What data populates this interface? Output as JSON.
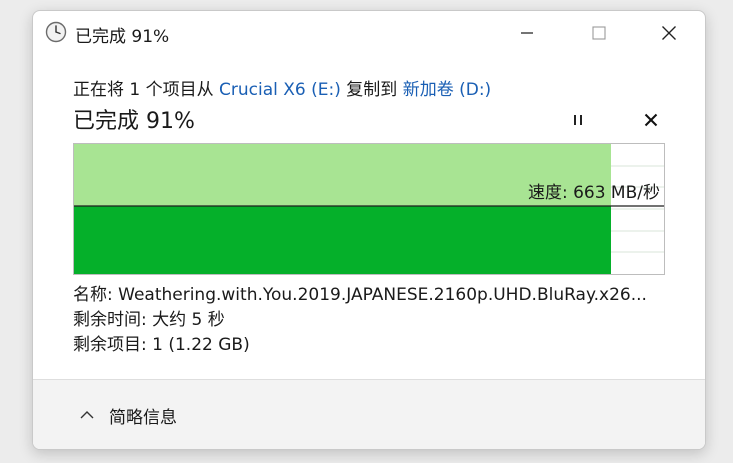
{
  "window": {
    "title": "已完成 91%",
    "controls": [
      "minimize-icon",
      "maximize-icon",
      "close-icon"
    ]
  },
  "copy": {
    "prefix": "正在将 1 个项目从 ",
    "source": "Crucial X6 (E:)",
    "middle": " 复制到 ",
    "destination": "新加卷 (D:)",
    "heading": "已完成 91%",
    "progress_fraction": 0.91
  },
  "graph": {
    "speed_label": "速度: 663 MB/秒",
    "colors": {
      "progress_fill": "#a8e493",
      "speed_area": "#05b02a",
      "speed_line": "#1f1f1f",
      "grid": "#d8e6d8"
    }
  },
  "details": {
    "name": "名称:  Weathering.with.You.2019.JAPANESE.2160p.UHD.BluRay.x26...",
    "time_remaining": "剩余时间: 大约 5 秒",
    "items_remaining": "剩余项目: 1 (1.22 GB)"
  },
  "footer": {
    "toggle_label": "简略信息"
  },
  "icons": {
    "title": "clock-icon",
    "pause": "pause-icon",
    "cancel": "cancel-icon",
    "toggle": "chevron-up-icon"
  }
}
